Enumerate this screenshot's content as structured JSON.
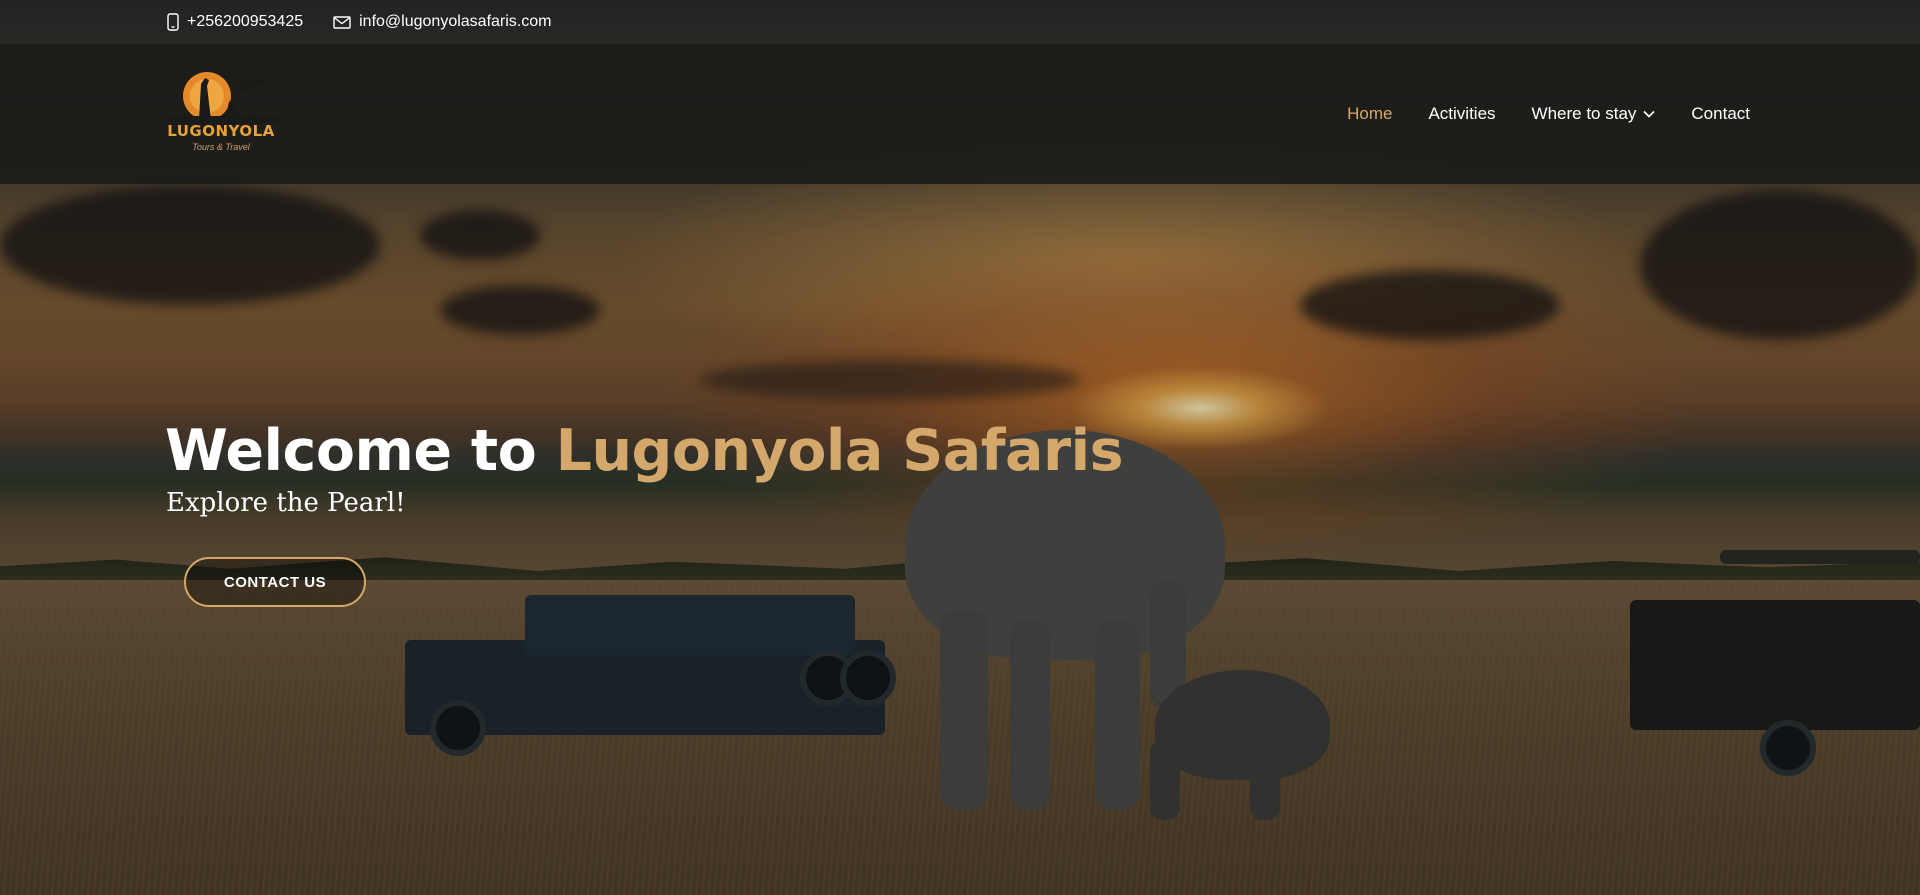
{
  "topbar": {
    "phone": "+256200953425",
    "email": "info@lugonyolasafaris.com",
    "phone_icon": "phone-icon",
    "email_icon": "envelope-icon"
  },
  "logo": {
    "name": "LUGONYOLA",
    "tagline": "Tours & Travel"
  },
  "nav": {
    "items": [
      {
        "label": "Home",
        "active": true
      },
      {
        "label": "Activities"
      },
      {
        "label": "Where to stay",
        "dropdown": true
      },
      {
        "label": "Contact"
      }
    ]
  },
  "hero": {
    "title_lead": "Welcome to ",
    "title_accent": "Lugonyola Safaris",
    "subtitle": "Explore the Pearl!",
    "cta_label": "CONTACT US"
  },
  "colors": {
    "accent": "#d3a86a",
    "header_bg": "#1a1a18",
    "text": "#ffffff"
  }
}
